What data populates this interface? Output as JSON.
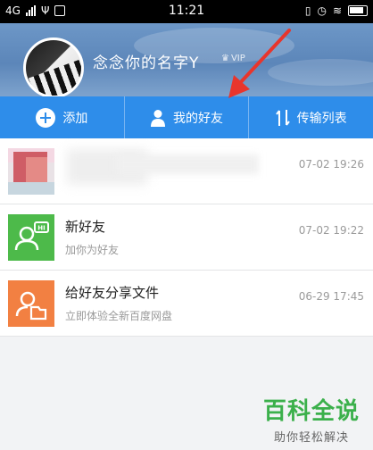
{
  "status_bar": {
    "network": "4G",
    "time": "11:21"
  },
  "profile": {
    "username": "念念你的名字Y",
    "vip_label": "VIP"
  },
  "toolbar": {
    "add": "添加",
    "friends": "我的好友",
    "transfers": "传输列表"
  },
  "items": [
    {
      "title": "",
      "subtitle": "",
      "time": "07-02 19:26"
    },
    {
      "title": "新好友",
      "subtitle": "加你为好友",
      "time": "07-02 19:22"
    },
    {
      "title": "给好友分享文件",
      "subtitle": "立即体验全新百度网盘",
      "time": "06-29 17:45"
    }
  ],
  "watermark": {
    "line1": "百科全说",
    "line2": "助你轻松解决"
  },
  "colors": {
    "toolbar": "#2e8dea",
    "new_friend_icon": "#4dba4a",
    "share_icon": "#f28042"
  }
}
